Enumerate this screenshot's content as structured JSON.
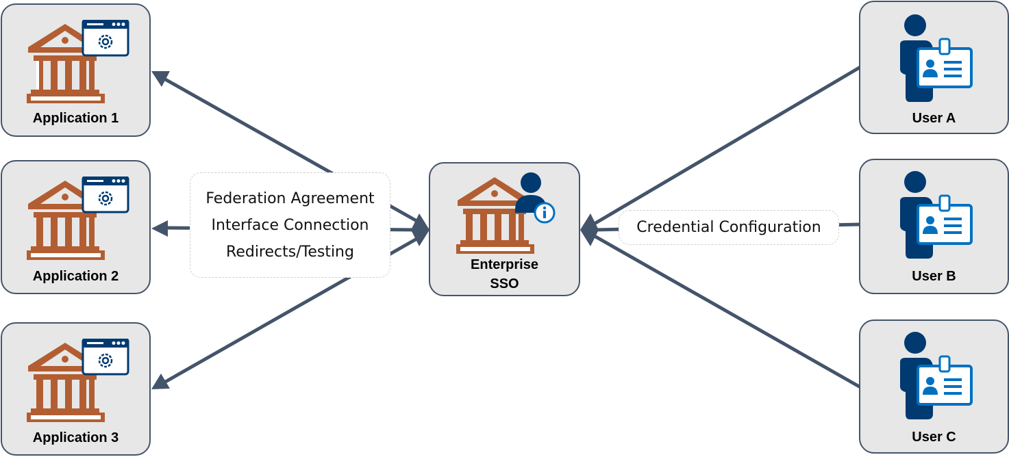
{
  "colors": {
    "connector": "#44546a",
    "node_fill": "#e7e7e7",
    "institution": "#b25e32",
    "user_dark": "#003a70",
    "badge_blue": "#0070c0"
  },
  "applications": [
    {
      "label": "Application 1",
      "icon": "institution-with-settings-window-icon"
    },
    {
      "label": "Application 2",
      "icon": "institution-with-settings-window-icon"
    },
    {
      "label": "Application 3",
      "icon": "institution-with-settings-window-icon"
    }
  ],
  "hub": {
    "label_line1": "Enterprise",
    "label_line2": "SSO",
    "icon": "institution-with-user-info-icon"
  },
  "users": [
    {
      "label": "User A",
      "icon": "user-with-id-badge-icon"
    },
    {
      "label": "User B",
      "icon": "user-with-id-badge-icon"
    },
    {
      "label": "User C",
      "icon": "user-with-id-badge-icon"
    }
  ],
  "left_note": {
    "lines": [
      "Federation Agreement",
      "Interface Connection",
      "Redirects/Testing"
    ]
  },
  "right_note": {
    "text": "Credential Configuration"
  }
}
